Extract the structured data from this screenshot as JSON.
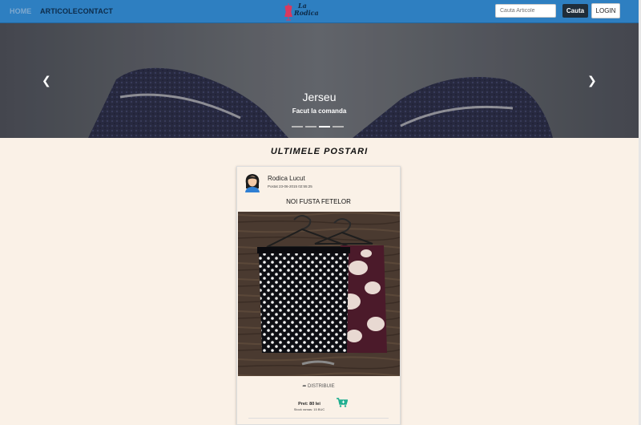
{
  "nav": {
    "home": "HOME",
    "articles": "ARTICOLE",
    "contact": "CONTACT",
    "logo_line1": "La",
    "logo_line2": "Rodica",
    "search_placeholder": "Cauta Articole",
    "search_button": "Cauta",
    "login_button": "LOGIN"
  },
  "carousel": {
    "title": "Jerseu",
    "subtitle": "Facut la comanda",
    "prev_icon": "chevron-left-icon",
    "next_icon": "chevron-right-icon",
    "slide_count": 4,
    "active_slide": 3
  },
  "section": {
    "title": "ULTIMELE POSTARI"
  },
  "post": {
    "author": "Rodica Lucut",
    "posted": "Postat 23-06-2015 02:55:25",
    "title": "NOI FUSTA FETELOR",
    "share_label": "DISTRIBUIE",
    "price": "Pret: 80 lei",
    "stock": "Stock ramas: 15 BUC"
  },
  "colors": {
    "navbar": "#2e7fc1",
    "page_background": "#faf1e7",
    "cart_icon": "#1fae8f"
  }
}
